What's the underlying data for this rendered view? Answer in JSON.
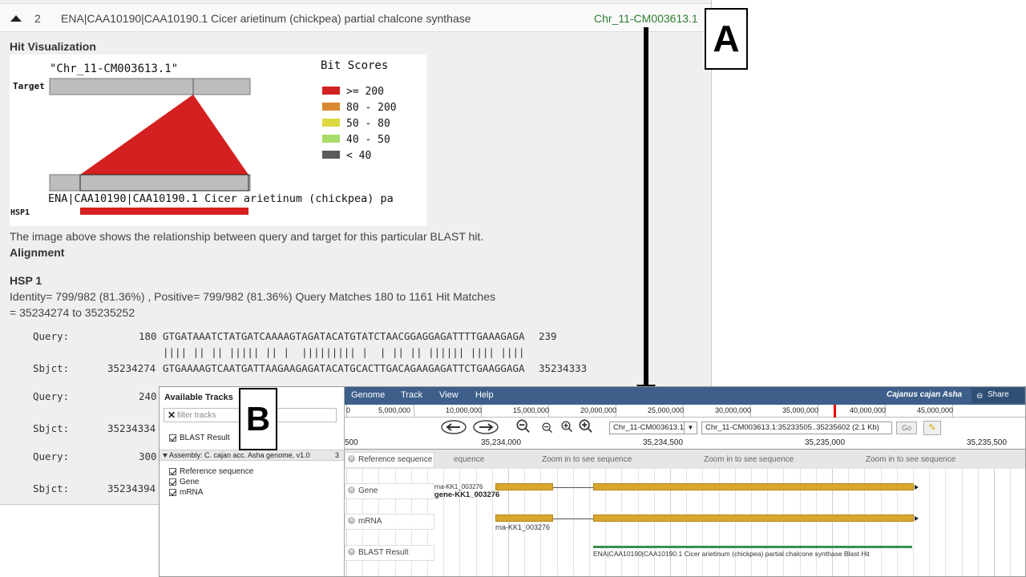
{
  "hit": {
    "number": "2",
    "description": "ENA|CAA10190|CAA10190.1 Cicer arietinum (chickpea) partial chalcone synthase",
    "chromosome_link": "Chr_11-CM003613.1"
  },
  "hit_visualization": {
    "heading": "Hit Visualization",
    "target_name": "\"Chr_11-CM003613.1\"",
    "target_label": "Target",
    "query_name": "ENA|CAA10190|CAA10190.1 Cicer arietinum (chickpea) pa",
    "hsp_label": "HSP1",
    "legend_title": "Bit Scores",
    "legend": [
      {
        "label": ">= 200",
        "color": "#d42020"
      },
      {
        "label": "80 - 200",
        "color": "#d88830"
      },
      {
        "label": "50 - 80",
        "color": "#dcd840"
      },
      {
        "label": "40 - 50",
        "color": "#a8dc68"
      },
      {
        "label": "< 40",
        "color": "#5a5a5a"
      }
    ],
    "caption": "The image above shows the relationship between query and target for this particular BLAST hit."
  },
  "alignment": {
    "heading": "Alignment",
    "hsp_heading": "HSP 1",
    "summary_line1": "Identity=  799/982 (81.36%) ,  Positive=  799/982 (81.36%) Query Matches 180 to 1161 Hit Matches",
    "summary_line2": "= 35234274 to 35235252",
    "rows": [
      {
        "label": "Query:",
        "start": "180",
        "seq": "GTGATAAATCTATGATCAAAAGTAGATACATGTATCTAACGGAGGAGATTTTGAAAGAGA",
        "end": "239"
      },
      {
        "label": "",
        "start": "",
        "seq": "|||| || || ||||| || |  ||||||||| |  | || || |||||| |||| ||||",
        "end": ""
      },
      {
        "label": "Sbjct:",
        "start": "35234274",
        "seq": "GTGAAAAGTCAATGATTAAGAAGAGATACATGCACTTGACAGAAGAGATTCTGAAGGAGA",
        "end": "35234333"
      },
      {
        "label": "Query:",
        "start": "240",
        "seq": "",
        "end": ""
      },
      {
        "label": "Sbjct:",
        "start": "35234334",
        "seq": "",
        "end": ""
      },
      {
        "label": "Query:",
        "start": "300",
        "seq": "",
        "end": ""
      },
      {
        "label": "Sbjct:",
        "start": "35234394",
        "seq": "",
        "end": ""
      }
    ]
  },
  "labels": {
    "a": "A",
    "b": "B"
  },
  "jbrowse": {
    "tracklist": {
      "title": "Available Tracks",
      "filter_placeholder": "filter tracks",
      "blast_result": "BLAST Result",
      "assembly": "Assembly: C. cajan acc. Asha genome, v1.0",
      "assembly_count": "3",
      "reference_sequence": "Reference sequence",
      "gene": "Gene",
      "mrna": "mRNA"
    },
    "menu": {
      "genome": "Genome",
      "track": "Track",
      "view": "View",
      "help": "Help",
      "organism": "Cajanus cajan Asha",
      "share": "Share"
    },
    "overview_ticks": [
      "0",
      "5,000,000",
      "10,000,000",
      "15,000,000",
      "20,000,000",
      "25,000,000",
      "30,000,000",
      "35,000,000",
      "40,000,000",
      "45,000,000"
    ],
    "ref_select": "Chr_11-CM003613.1",
    "location": "Chr_11-CM003613.1:35233505..35235602 (2.1 Kb)",
    "go": "Go",
    "ruler_ticks": [
      "500",
      "35,234,000",
      "35,234,500",
      "35,235,000",
      "35,235,500"
    ],
    "tracks": {
      "reference_sequence": "Reference sequence",
      "zoom_text": "Zoom in to see sequence",
      "partial_zoom_text": "equence",
      "gene": "Gene",
      "mrna": "mRNA",
      "blast_result": "BLAST Result"
    },
    "features": {
      "gene_small_label": "rna-KK1_003276",
      "gene_label": "gene-KK1_003276",
      "mrna_label": "rna-KK1_003276",
      "blast_hit_label": "ENA|CAA10190|CAA10190.1 Cicer arietinum (chickpea) partial chalcone synthase Blast Hit"
    }
  }
}
